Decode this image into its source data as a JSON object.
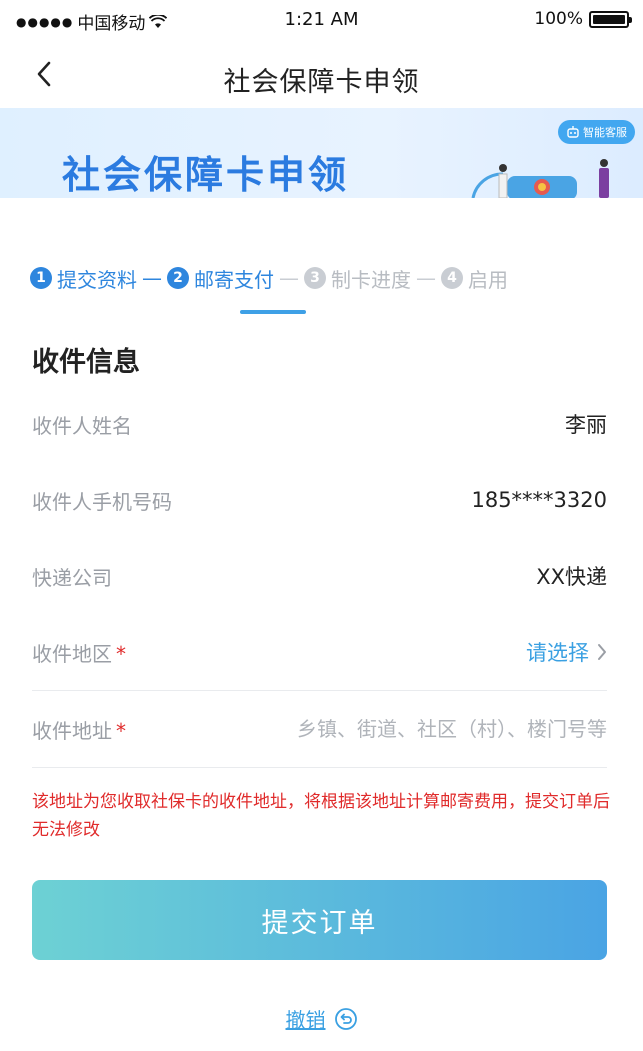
{
  "status_bar": {
    "signal": "●●●●●",
    "carrier": "中国移动",
    "time": "1:21 AM",
    "battery": "100%",
    "battery_level": 1.0
  },
  "nav": {
    "title": "社会保障卡申领",
    "back_icon": "chevron-left-icon"
  },
  "banner": {
    "title": "社会保障卡申领",
    "badge": "智能客服"
  },
  "steps": [
    {
      "num": "1",
      "label": "提交资料",
      "state": "done"
    },
    {
      "num": "2",
      "label": "邮寄支付",
      "state": "active"
    },
    {
      "num": "3",
      "label": "制卡进度",
      "state": "todo"
    },
    {
      "num": "4",
      "label": "启用",
      "state": "todo"
    }
  ],
  "step_separator": "—",
  "section": {
    "title": "收件信息"
  },
  "form": {
    "recipient_name_label": "收件人姓名",
    "recipient_name_value": "李丽",
    "recipient_phone_label": "收件人手机号码",
    "recipient_phone_value": "185****3320",
    "courier_label": "快递公司",
    "courier_value": "XX快递",
    "region_label": "收件地区",
    "region_value": "请选择",
    "address_label": "收件地址",
    "address_placeholder": "乡镇、街道、社区（村）、楼门号等",
    "required_mark": "*"
  },
  "notice": "该地址为您收取社保卡的收件地址，将根据该地址计算邮寄费用，提交订单后无法修改",
  "actions": {
    "submit_label": "提交订单",
    "cancel_label": "撤销"
  },
  "colors": {
    "accent": "#2e86de",
    "link": "#3aa0e2",
    "required": "#e02b2b",
    "button_gradient_start": "#6dd1d4",
    "button_gradient_end": "#4aa4e4"
  }
}
